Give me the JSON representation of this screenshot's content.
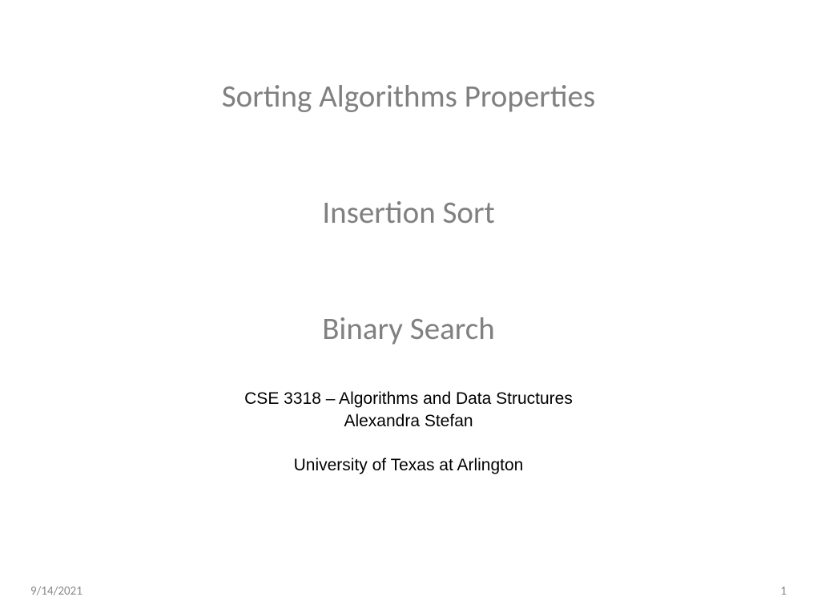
{
  "slide": {
    "titles": {
      "line1": "Sorting Algorithms Properties",
      "line2": "Insertion Sort",
      "line3": "Binary Search"
    },
    "subtitle": {
      "course": "CSE 3318 – Algorithms and Data Structures",
      "author": "Alexandra Stefan",
      "institution": "University of Texas at Arlington"
    },
    "footer": {
      "date": "9/14/2021",
      "page": "1"
    }
  }
}
